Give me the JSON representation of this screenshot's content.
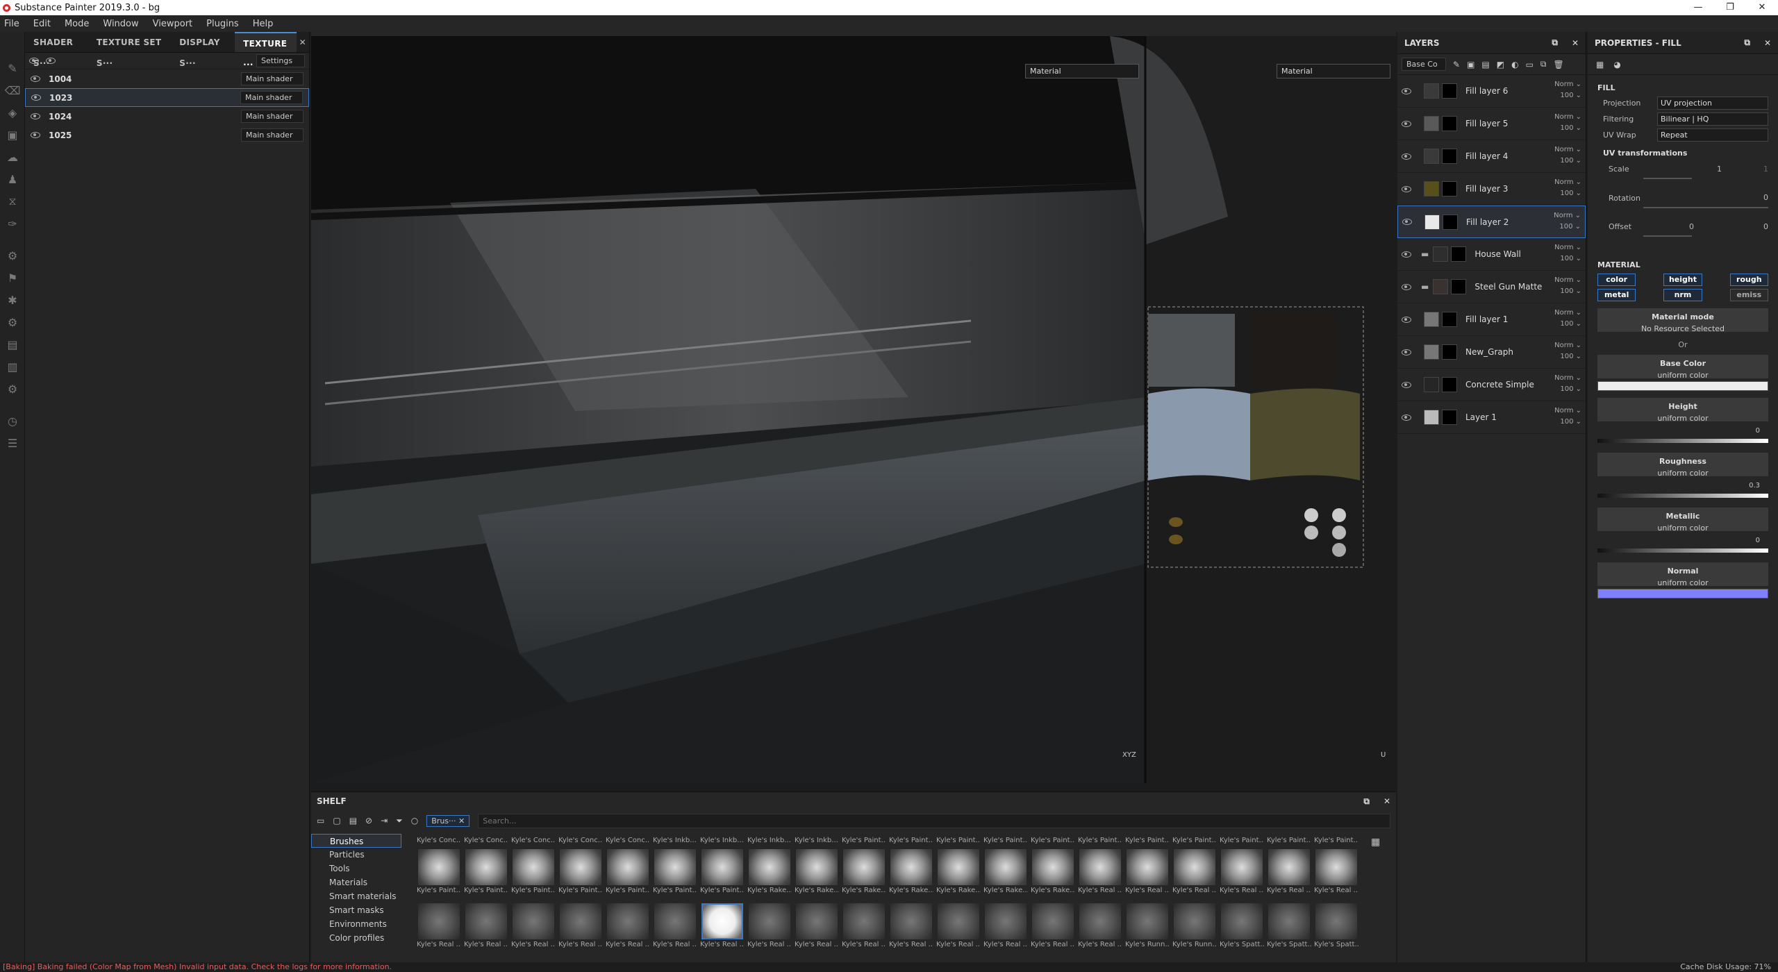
{
  "window": {
    "title": "Substance Painter 2019.3.0 - bg",
    "minimize": "—",
    "maximize": "❐",
    "close": "✕"
  },
  "menu": [
    "File",
    "Edit",
    "Mode",
    "Window",
    "Viewport",
    "Plugins",
    "Help"
  ],
  "tabs": [
    "SHADER S···",
    "TEXTURE SET S···",
    "DISPLAY S···",
    "TEXTURE ···"
  ],
  "tab_close": "✕",
  "texture_sets": {
    "settings_label": "Settings",
    "rows": [
      {
        "name": "1004",
        "shader": "Main shader"
      },
      {
        "name": "1023",
        "shader": "Main shader"
      },
      {
        "name": "1024",
        "shader": "Main shader"
      },
      {
        "name": "1025",
        "shader": "Main shader"
      }
    ]
  },
  "viewport": {
    "mode_left": "Material",
    "mode_right": "Material",
    "gizmo_left": "XYZ",
    "gizmo_right": "U"
  },
  "layers": {
    "title": "LAYERS",
    "channel": "Base Co",
    "rows": [
      {
        "name": "Fill layer 6",
        "blend": "Norm",
        "opacity": "100",
        "thumb": "#3a3a3a",
        "sel": false
      },
      {
        "name": "Fill layer 5",
        "blend": "Norm",
        "opacity": "100",
        "thumb": "#595959",
        "sel": false
      },
      {
        "name": "Fill layer 4",
        "blend": "Norm",
        "opacity": "100",
        "thumb": "#3a3a3a",
        "sel": false
      },
      {
        "name": "Fill layer 3",
        "blend": "Norm",
        "opacity": "100",
        "thumb": "#57501a",
        "sel": false
      },
      {
        "name": "Fill layer 2",
        "blend": "Norm",
        "opacity": "100",
        "thumb": "#e8e8e8",
        "sel": true
      },
      {
        "name": "House Wall",
        "blend": "Norm",
        "opacity": "100",
        "thumb": "#2e2e2e",
        "sel": false
      },
      {
        "name": "Steel Gun Matte",
        "blend": "Norm",
        "opacity": "100",
        "thumb": "#3a3231",
        "sel": false
      },
      {
        "name": "Fill layer 1",
        "blend": "Norm",
        "opacity": "100",
        "thumb": "#777777",
        "sel": false
      },
      {
        "name": "New_Graph",
        "blend": "Norm",
        "opacity": "100",
        "thumb": "#777777",
        "sel": false
      },
      {
        "name": "Concrete Simple",
        "blend": "Norm",
        "opacity": "100",
        "thumb": "#262626",
        "sel": false
      },
      {
        "name": "Layer 1",
        "blend": "Norm",
        "opacity": "100",
        "thumb": "#bbbbbb",
        "sel": false
      }
    ]
  },
  "properties": {
    "title": "PROPERTIES - FILL",
    "section": "FILL",
    "projection_label": "Projection",
    "projection": "UV projection",
    "filtering_label": "Filtering",
    "filtering": "Bilinear | HQ",
    "uvwrap_label": "UV Wrap",
    "uvwrap": "Repeat",
    "uvt": "UV transformations",
    "scale_label": "Scale",
    "scale": "1",
    "scale2": "1",
    "rotation_label": "Rotation",
    "rotation": "0",
    "offset_label": "Offset",
    "offset": "0",
    "offset2": "0",
    "material": "MATERIAL",
    "channels": [
      "color",
      "height",
      "rough",
      "metal",
      "nrm",
      "emiss"
    ],
    "mat_mode": "Material mode",
    "no_res": "No Resource Selected",
    "or": "Or",
    "base_color": "Base Color",
    "height": "Height",
    "roughness": "Roughness",
    "metallic": "Metallic",
    "normal": "Normal",
    "uniform": "uniform color",
    "height_val": "0",
    "rough_val": "0.3",
    "metal_val": "0",
    "base_swatch": "#eeeeee",
    "normal_swatch": "#8080ff"
  },
  "shelf": {
    "title": "SHELF",
    "filter_tag": "Brus···",
    "search_placeholder": "Search...",
    "categories": [
      "Brushes",
      "Particles",
      "Tools",
      "Materials",
      "Smart materials",
      "Smart masks",
      "Environments",
      "Color profiles"
    ],
    "row1_top": [
      "Kyle's Conc...",
      "Kyle's Conc...",
      "Kyle's Conc...",
      "Kyle's Conc...",
      "Kyle's Conc...",
      "Kyle's Inkb...",
      "Kyle's Inkb...",
      "Kyle's Inkb...",
      "Kyle's Inkb...",
      "Kyle's Paint...",
      "Kyle's Paint...",
      "Kyle's Paint...",
      "Kyle's Paint...",
      "Kyle's Paint...",
      "Kyle's Paint...",
      "Kyle's Paint...",
      "Kyle's Paint...",
      "Kyle's Paint...",
      "Kyle's Paint...",
      "Kyle's Paint..."
    ],
    "row1_bot": [
      "Kyle's Paint...",
      "Kyle's Paint...",
      "Kyle's Paint...",
      "Kyle's Paint...",
      "Kyle's Paint...",
      "Kyle's Paint...",
      "Kyle's Paint...",
      "Kyle's Rake...",
      "Kyle's Rake...",
      "Kyle's Rake...",
      "Kyle's Rake...",
      "Kyle's Rake...",
      "Kyle's Rake...",
      "Kyle's Rake...",
      "Kyle's Real ...",
      "Kyle's Real ...",
      "Kyle's Real ...",
      "Kyle's Real ...",
      "Kyle's Real ...",
      "Kyle's Real ..."
    ],
    "row2_bot": [
      "Kyle's Real ...",
      "Kyle's Real ...",
      "Kyle's Real ...",
      "Kyle's Real ...",
      "Kyle's Real ...",
      "Kyle's Real ...",
      "Kyle's Real ...",
      "Kyle's Real ...",
      "Kyle's Real ...",
      "Kyle's Real ...",
      "Kyle's Real ...",
      "Kyle's Real ...",
      "Kyle's Real ...",
      "Kyle's Real ...",
      "Kyle's Real ...",
      "Kyle's Runn...",
      "Kyle's Runn...",
      "Kyle's Spatt...",
      "Kyle's Spatt...",
      "Kyle's Spatt..."
    ]
  },
  "status": {
    "message": "[Baking] Baking failed (Color Map from Mesh) Invalid input data. Check the logs for more information.",
    "cache": "Cache Disk Usage:  71%"
  }
}
